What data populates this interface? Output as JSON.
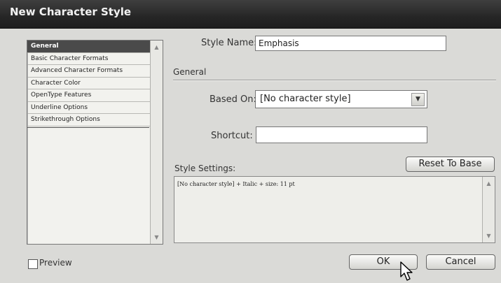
{
  "window": {
    "title": "New Character Style"
  },
  "sidebar": {
    "items": [
      {
        "label": "General",
        "selected": true
      },
      {
        "label": "Basic Character Formats"
      },
      {
        "label": "Advanced Character Formats"
      },
      {
        "label": "Character Color"
      },
      {
        "label": "OpenType Features"
      },
      {
        "label": "Underline Options"
      },
      {
        "label": "Strikethrough Options"
      }
    ]
  },
  "form": {
    "style_name_label": "Style Name:",
    "style_name_value": "Emphasis",
    "section_title": "General",
    "based_on_label": "Based On:",
    "based_on_value": "[No character style]",
    "shortcut_label": "Shortcut:",
    "shortcut_value": "",
    "style_settings_label": "Style Settings:",
    "reset_button": "Reset To Base",
    "style_settings_text": "[No character style] + Italic + size: 11 pt"
  },
  "footer": {
    "preview_label": "Preview",
    "preview_checked": false,
    "ok_button": "OK",
    "cancel_button": "Cancel"
  },
  "icons": {
    "scroll_up": "▲",
    "scroll_down": "▼",
    "dropdown": "▼"
  }
}
